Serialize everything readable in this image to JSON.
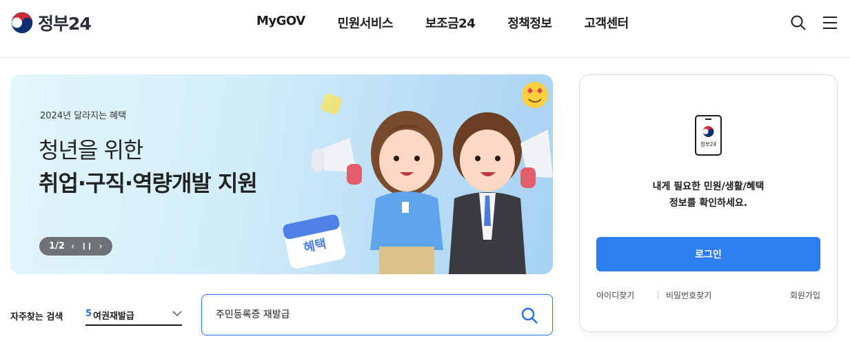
{
  "header": {
    "logo_text": "정부24",
    "nav": [
      {
        "label": "MyGOV"
      },
      {
        "label": "민원서비스"
      },
      {
        "label": "보조금24"
      },
      {
        "label": "정책정보"
      },
      {
        "label": "고객센터"
      }
    ],
    "icons": [
      "search-icon",
      "menu-icon"
    ]
  },
  "banner": {
    "subtitle": "2024년 달라지는 혜택",
    "title_line1": "청년을 위한",
    "title_line2": "취업·구직·역량개발 지원",
    "pager": "1/2",
    "calendar_label": "혜택"
  },
  "frequent_search": {
    "label": "자주찾는 검색",
    "rank": "5",
    "item": "여권재발급"
  },
  "search": {
    "value": "주민등록증 재발급"
  },
  "login": {
    "phone_label": "정부24",
    "message_line1": "내게 필요한 민원/생활/혜택",
    "message_line2": "정보를 확인하세요.",
    "button": "로그인",
    "find_id": "아이디찾기",
    "find_pw": "비밀번호찾기",
    "signup": "회원가입"
  },
  "colors": {
    "accent": "#256ef4",
    "login_button": "#2e7ef0",
    "pager_bg": "#6e7276"
  }
}
